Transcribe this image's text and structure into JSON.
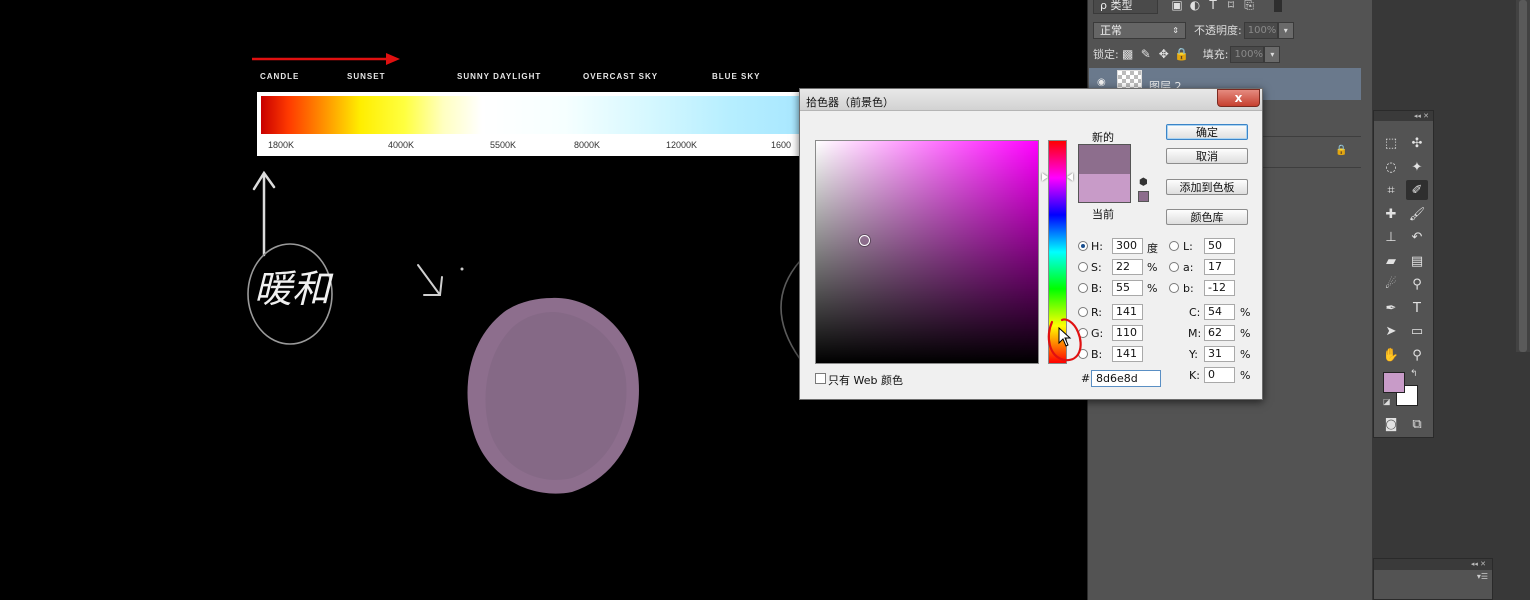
{
  "canvas": {
    "temperature_labels": [
      "CANDLE",
      "SUNSET",
      "SUNNY DAYLIGHT",
      "OVERCAST SKY",
      "BLUE SKY"
    ],
    "scale_labels": [
      "1800K",
      "4000K",
      "5500K",
      "8000K",
      "12000K",
      "1600"
    ],
    "handwriting": "暖和",
    "blob_color": "#8d6e8d",
    "annotation_color": "#e01010"
  },
  "layers_panel": {
    "filter_label": "ρ 类型",
    "blend_mode": "正常",
    "opacity_label": "不透明度:",
    "opacity_value": "100%",
    "lock_label": "锁定:",
    "fill_label": "填充:",
    "fill_value": "100%",
    "layer_name": "图层 2"
  },
  "color_picker": {
    "title": "拾色器（前景色）",
    "close_glyph": "x",
    "new_label": "新的",
    "current_label": "当前",
    "new_color": "#8d6e8d",
    "current_color": "#c89bc8",
    "hue_color": "#ff00ff",
    "buttons": {
      "ok": "确定",
      "cancel": "取消",
      "add_to_swatches": "添加到色板",
      "color_libraries": "颜色库"
    },
    "fields": {
      "H": {
        "label": "H:",
        "value": "300",
        "unit": "度"
      },
      "S": {
        "label": "S:",
        "value": "22",
        "unit": "%"
      },
      "B": {
        "label": "B:",
        "value": "55",
        "unit": "%"
      },
      "R": {
        "label": "R:",
        "value": "141"
      },
      "G": {
        "label": "G:",
        "value": "110"
      },
      "Bl": {
        "label": "B:",
        "value": "141"
      },
      "L": {
        "label": "L:",
        "value": "50"
      },
      "a": {
        "label": "a:",
        "value": "17"
      },
      "b": {
        "label": "b:",
        "value": "-12"
      },
      "C": {
        "label": "C:",
        "value": "54",
        "unit": "%"
      },
      "M": {
        "label": "M:",
        "value": "62",
        "unit": "%"
      },
      "Y": {
        "label": "Y:",
        "value": "31",
        "unit": "%"
      },
      "K": {
        "label": "K:",
        "value": "0",
        "unit": "%"
      }
    },
    "hex_label": "#",
    "hex_value": "8d6e8d",
    "web_only_label": "只有 Web 颜色"
  },
  "toolbox": {
    "foreground_color": "#c89bc8",
    "background_color": "#ffffff"
  }
}
